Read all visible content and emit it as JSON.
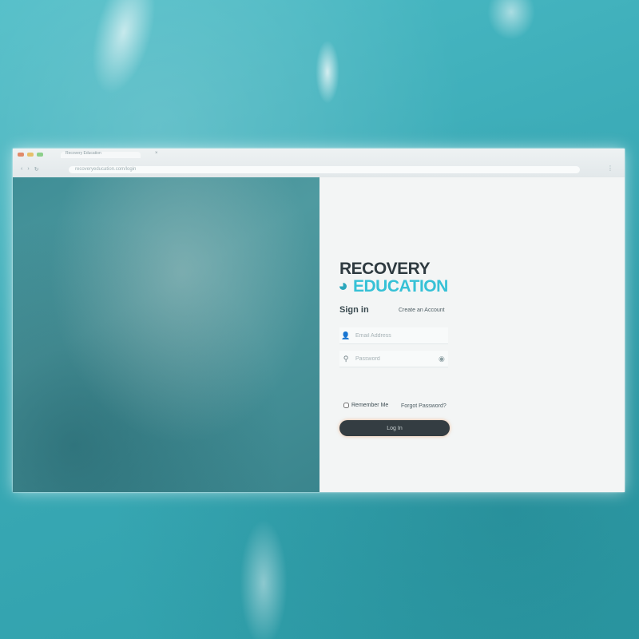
{
  "browser": {
    "tab_title": "Recovery Education",
    "url": "recoveryeducation.com/login"
  },
  "brand": {
    "name_line1": "RECOVERY",
    "name_line2": "EDUCATION",
    "primary_color": "#36c1d6",
    "text_color": "#2e3a40"
  },
  "login": {
    "title": "Sign in",
    "create_account_label": "Create an Account",
    "email_placeholder": "Email Address",
    "password_placeholder": "Password",
    "remember_label": "Remember Me",
    "forgot_label": "Forgot Password?",
    "submit_label": "Log In",
    "button_color": "#343d42"
  },
  "icons": {
    "email": "user-icon",
    "password": "key-icon",
    "reveal": "eye-icon"
  }
}
